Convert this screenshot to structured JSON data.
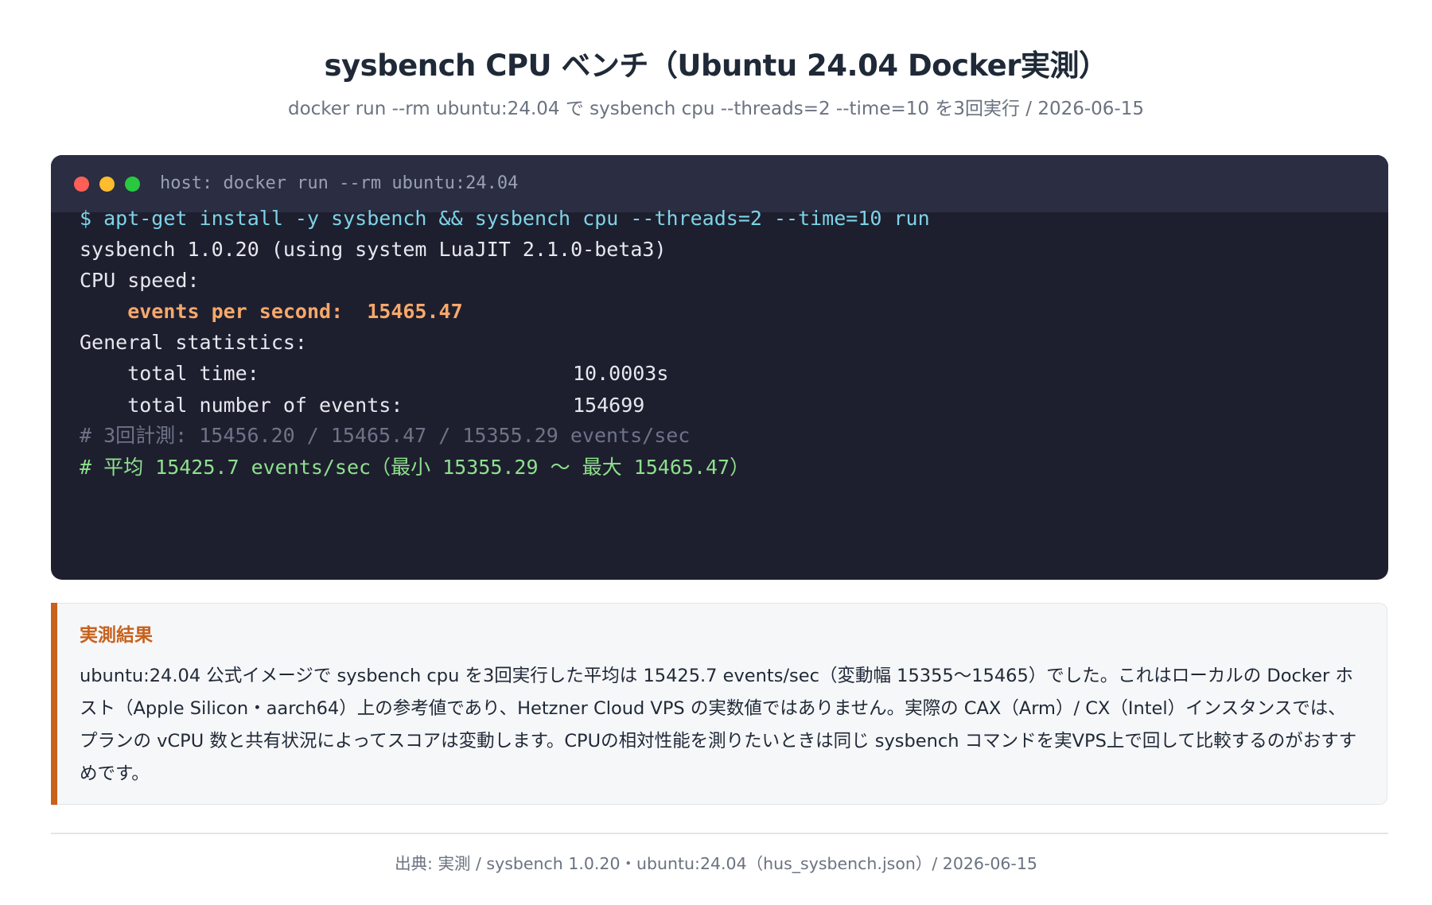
{
  "header": {
    "title": "sysbench CPU ベンチ（Ubuntu 24.04 Docker実測）",
    "subtitle": "docker run --rm ubuntu:24.04 で sysbench cpu --threads=2 --time=10 を3回実行 / 2026-06-15"
  },
  "terminal": {
    "host_label": "host: docker run --rm ubuntu:24.04",
    "window_buttons": [
      "close",
      "minimize",
      "maximize"
    ],
    "lines": {
      "command": "$ apt-get install -y sysbench && sysbench cpu --threads=2 --time=10 run",
      "version": "sysbench 1.0.20 (using system LuaJIT 2.1.0-beta3)",
      "cpu_speed_header": "CPU speed:",
      "events_per_second": "    events per second:  15465.47",
      "general_stats_header": "General statistics:",
      "total_time_label": "    total time:",
      "total_time_value": "10.0003s",
      "total_events_label": "    total number of events:",
      "total_events_value": "154699",
      "runs_comment": "# 3回計測: 15456.20 / 15465.47 / 15355.29 events/sec",
      "average_comment": "# 平均 15425.7 events/sec（最小 15355.29 〜 最大 15465.47）"
    }
  },
  "result": {
    "title": "実測結果",
    "body": "ubuntu:24.04 公式イメージで sysbench cpu を3回実行した平均は 15425.7 events/sec（変動幅 15355〜15465）でした。これはローカルの Docker ホスト（Apple Silicon・aarch64）上の参考値であり、Hetzner Cloud VPS の実数値ではありません。実際の CAX（Arm）/ CX（Intel）インスタンスでは、プランの vCPU 数と共有状況によってスコアは変動します。CPUの相対性能を測りたいときは同じ sysbench コマンドを実VPS上で回して比較するのがおすすめです。"
  },
  "footer": {
    "source": "出典: 実測 / sysbench 1.0.20・ubuntu:24.04（hus_sysbench.json）/ 2026-06-15"
  },
  "colors": {
    "terminal_bg": "#1e1f2e",
    "terminal_bar": "#2b2d42",
    "accent": "#c8611c",
    "command": "#7dd3e8",
    "highlight": "#f7a86b",
    "average": "#8ee08e",
    "comment": "#6e7388"
  }
}
